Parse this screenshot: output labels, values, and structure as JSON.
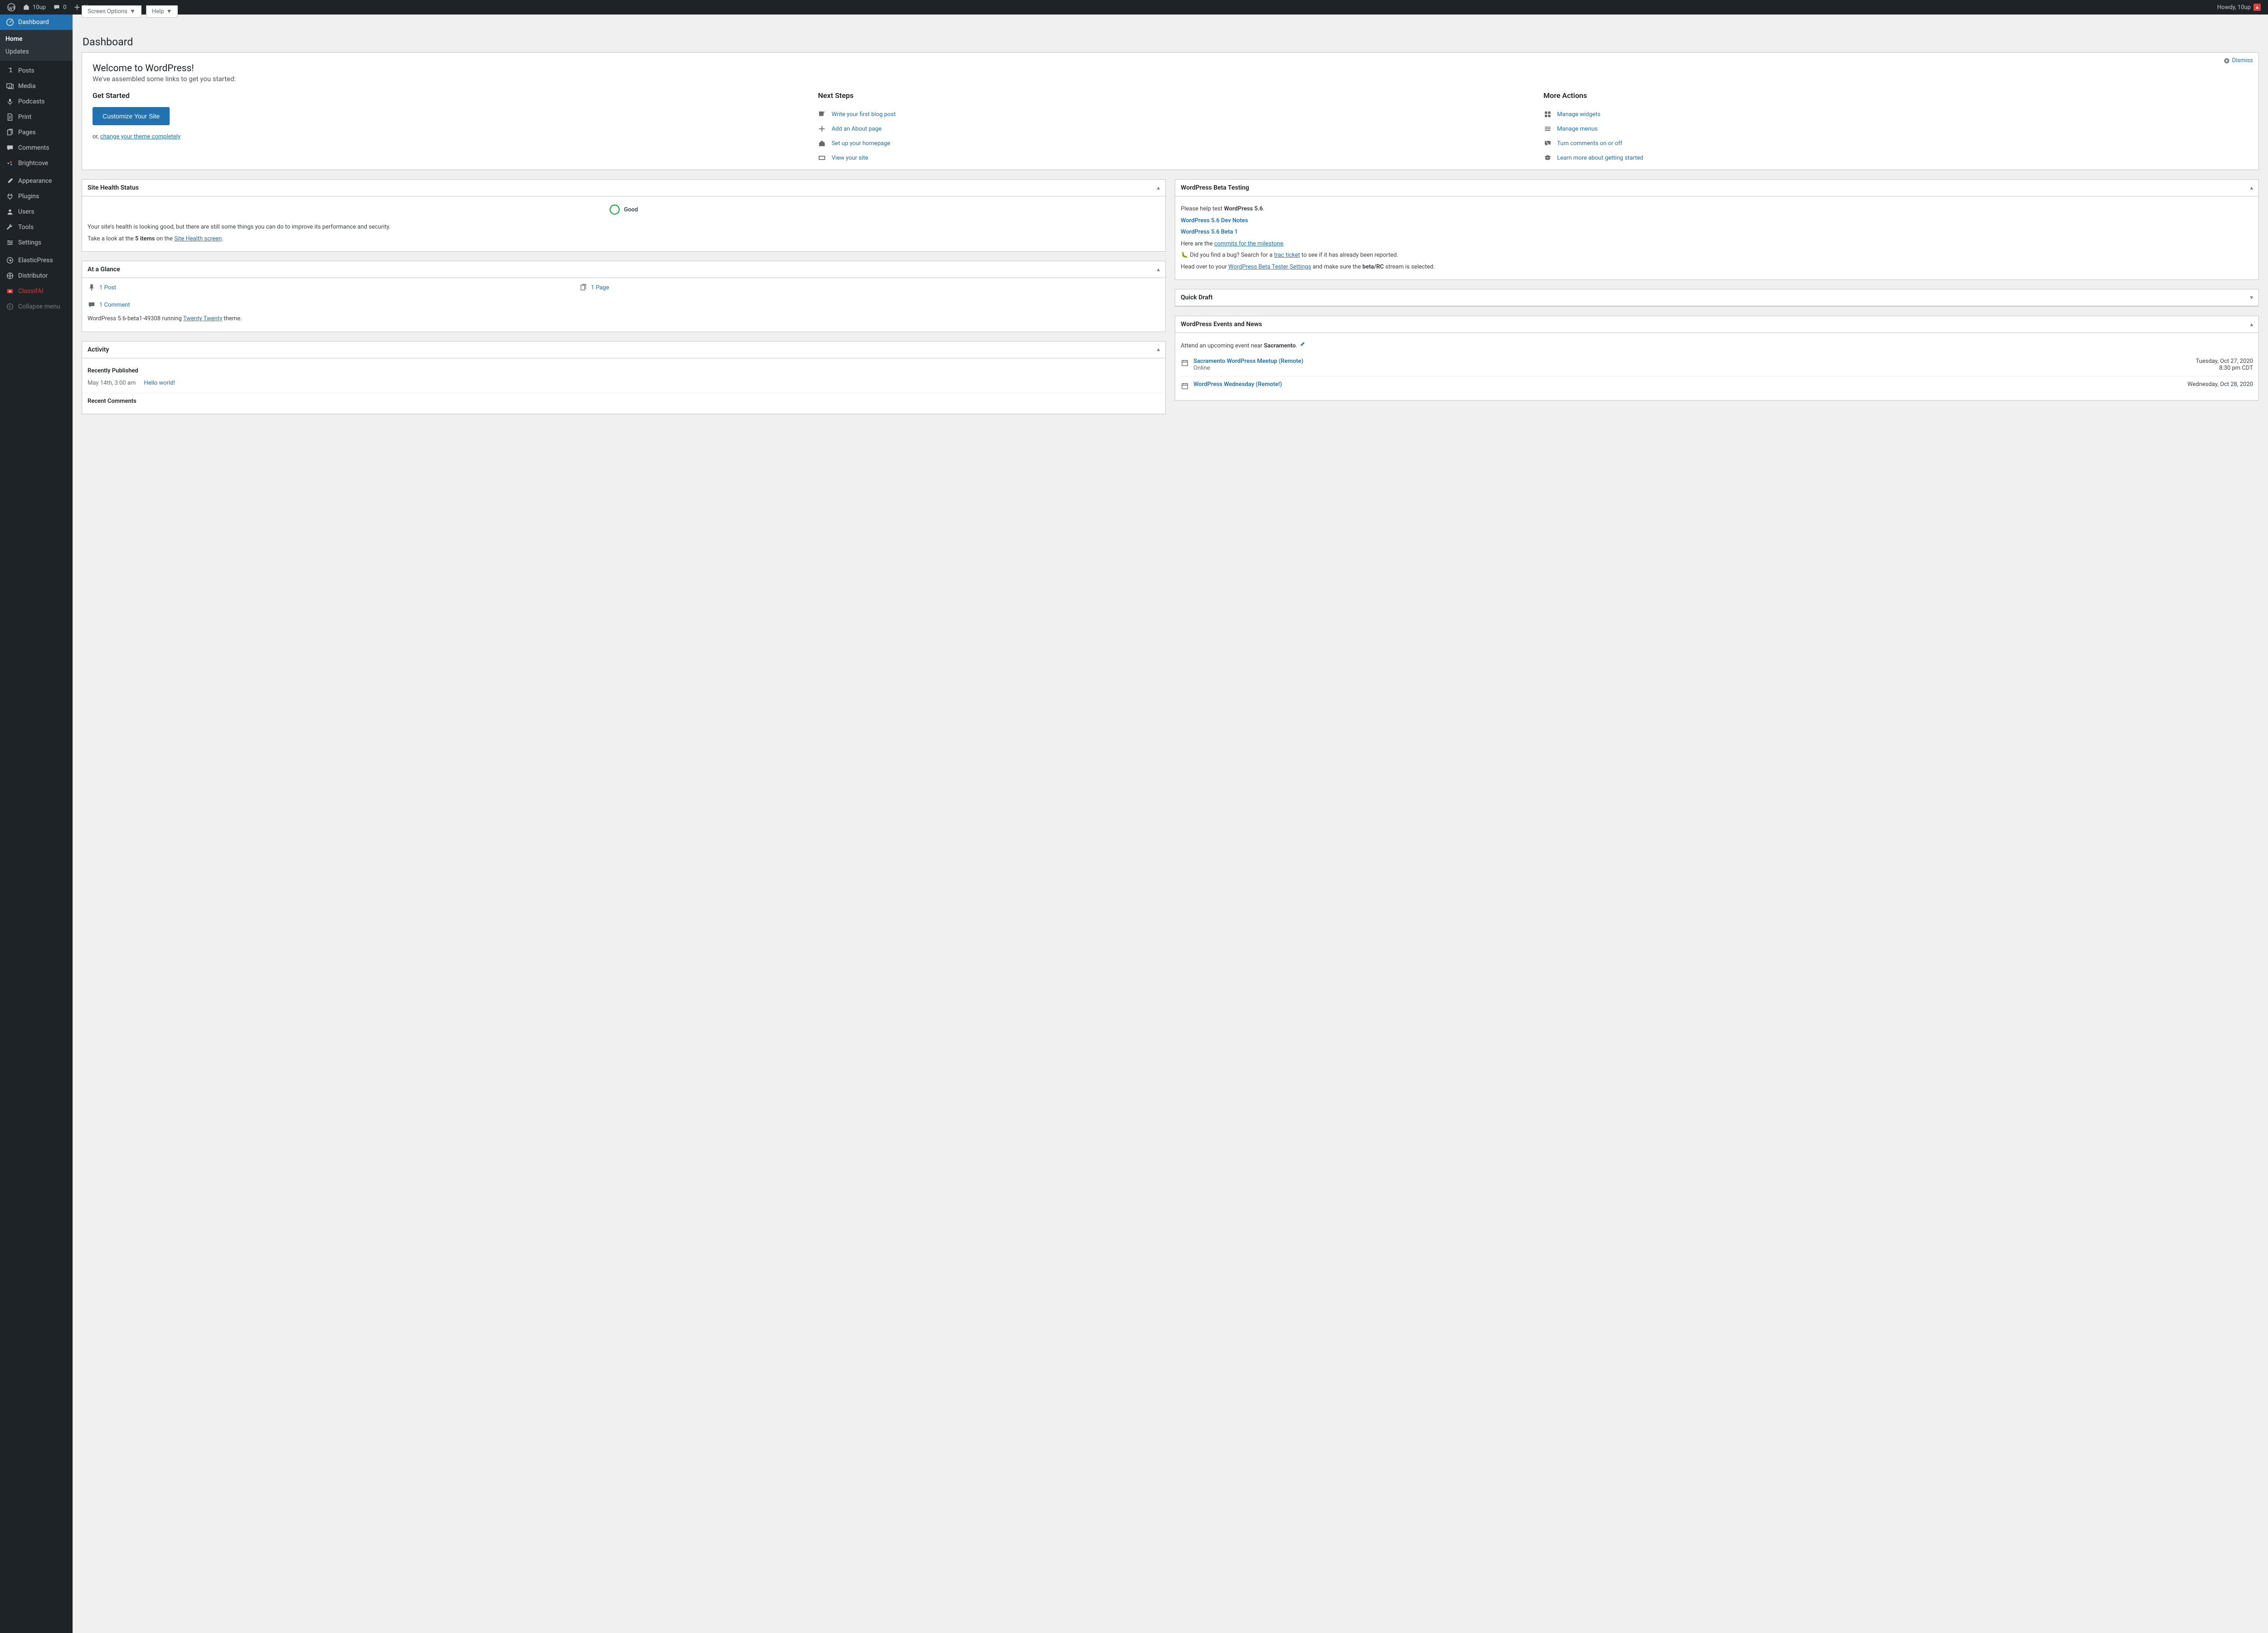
{
  "adminbar": {
    "site_name": "10up",
    "comments_count": "0",
    "new_label": "New",
    "howdy": "Howdy, 10up"
  },
  "sidebar": {
    "dashboard": "Dashboard",
    "home": "Home",
    "updates": "Updates",
    "items_a": [
      "Posts",
      "Media",
      "Podcasts",
      "Print",
      "Pages",
      "Comments",
      "Brightcove"
    ],
    "items_b": [
      "Appearance",
      "Plugins",
      "Users",
      "Tools",
      "Settings"
    ],
    "items_c": [
      "ElasticPress",
      "Distributor"
    ],
    "classifai": "ClassifAI",
    "collapse": "Collapse menu"
  },
  "header": {
    "title": "Dashboard",
    "screen_options": "Screen Options",
    "help": "Help"
  },
  "welcome": {
    "title": "Welcome to WordPress!",
    "subtitle": "We've assembled some links to get you started:",
    "dismiss": "Dismiss",
    "get_started": {
      "heading": "Get Started",
      "button": "Customize Your Site",
      "or_prefix": "or, ",
      "or_link": "change your theme completely"
    },
    "next_steps": {
      "heading": "Next Steps",
      "items": [
        "Write your first blog post",
        "Add an About page",
        "Set up your homepage",
        "View your site"
      ]
    },
    "more_actions": {
      "heading": "More Actions",
      "items": [
        "Manage widgets",
        "Manage menus",
        "Turn comments on or off",
        "Learn more about getting started"
      ]
    }
  },
  "site_health": {
    "title": "Site Health Status",
    "status": "Good",
    "p1": "Your site's health is looking good, but there are still some things you can do to improve its performance and security.",
    "p2a": "Take a look at the ",
    "p2b": "5 items",
    "p2c": " on the ",
    "p2d": "Site Health screen",
    "p2e": "."
  },
  "glance": {
    "title": "At a Glance",
    "post": "1 Post",
    "page": "1 Page",
    "comment": "1 Comment",
    "version_a": "WordPress 5.6-beta1-49308 running ",
    "theme": "Twenty Twenty",
    "version_b": " theme."
  },
  "activity": {
    "title": "Activity",
    "recently_published": "Recently Published",
    "pub_date": "May 14th, 3:00 am",
    "pub_title": "Hello world!",
    "recent_comments": "Recent Comments"
  },
  "beta": {
    "title": "WordPress Beta Testing",
    "p1a": "Please help test ",
    "p1b": "WordPress 5.6",
    "p1c": ".",
    "link1": "WordPress 5.6 Dev Notes",
    "link2": "WordPress 5.6 Beta 1",
    "p2a": "Here are the ",
    "p2b": "commits for the milestone",
    "p2c": ".",
    "p3a": "Did you find a bug? Search for a ",
    "p3b": "trac ticket",
    "p3c": " to see if it has already been reported.",
    "p4a": "Head over to your ",
    "p4b": "WordPress Beta Tester Settings",
    "p4c": " and make sure the ",
    "p4d": "beta/RC",
    "p4e": " stream is selected."
  },
  "quick_draft": {
    "title": "Quick Draft"
  },
  "events": {
    "title": "WordPress Events and News",
    "attend_a": "Attend an upcoming event near ",
    "attend_b": "Sacramento",
    "attend_c": ".",
    "list": [
      {
        "t": "Sacramento WordPress Meetup (Remote)",
        "loc": "Online",
        "d1": "Tuesday, Oct 27, 2020",
        "d2": "8:30 pm CDT"
      },
      {
        "t": "WordPress Wednesday (Remote!)",
        "loc": "",
        "d1": "Wednesday, Oct 28, 2020",
        "d2": ""
      }
    ]
  }
}
